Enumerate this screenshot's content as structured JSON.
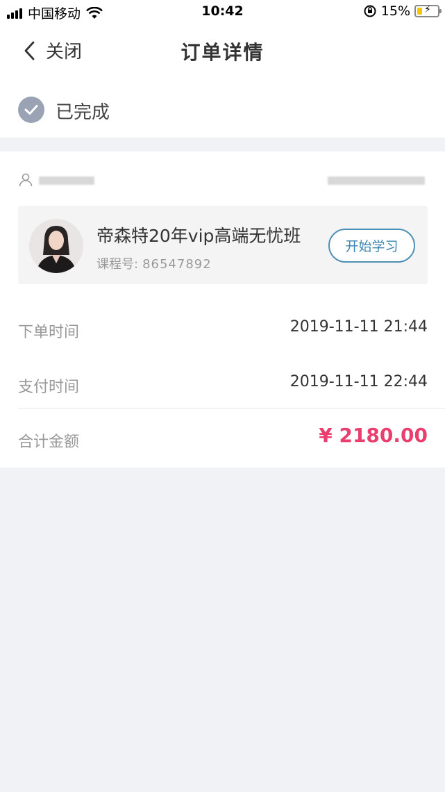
{
  "status_bar": {
    "carrier": "中国移动",
    "time": "10:42",
    "battery": "15%",
    "icons": [
      "signal-icon",
      "wifi-icon",
      "orientation-lock-icon",
      "battery-charging-icon"
    ]
  },
  "nav": {
    "back_label": "关闭",
    "title": "订单详情"
  },
  "order_status": {
    "label": "已完成",
    "icon": "check-circle-icon"
  },
  "user": {
    "icon": "user-icon"
  },
  "course": {
    "title": "帝森特20年vip高端无忧班",
    "number_label": "课程号:",
    "number": "86547892",
    "button_label": "开始学习"
  },
  "details": {
    "order_time_label": "下单时间",
    "order_time": "2019-11-11 21:44",
    "pay_time_label": "支付时间",
    "pay_time": "2019-11-11 22:44",
    "total_label": "合计金额",
    "total": "¥ 2180.00"
  },
  "colors": {
    "accent": "#3b84b2",
    "price": "#ea3e6f",
    "status_icon": "#9aa3b3",
    "background": "#f1f2f5"
  }
}
